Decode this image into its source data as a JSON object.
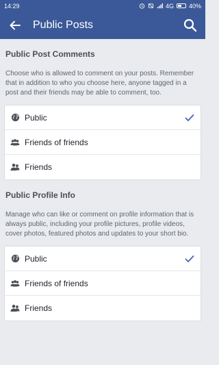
{
  "status_bar": {
    "time": "14:29",
    "network": "4G",
    "battery": "40%"
  },
  "header": {
    "title": "Public Posts"
  },
  "sections": [
    {
      "title": "Public Post Comments",
      "description": "Choose who is allowed to comment on your posts. Remember that in addition to who you choose here, anyone tagged in a post and their friends may be able to comment, too.",
      "options": [
        {
          "label": "Public",
          "icon": "globe-icon",
          "selected": true
        },
        {
          "label": "Friends of friends",
          "icon": "friends-of-friends-icon",
          "selected": false
        },
        {
          "label": "Friends",
          "icon": "friends-icon",
          "selected": false
        }
      ]
    },
    {
      "title": "Public Profile Info",
      "description": "Manage who can like or comment on profile information that is always public, including your profile pictures, profile videos, cover photos, featured photos and updates to your short bio.",
      "options": [
        {
          "label": "Public",
          "icon": "globe-icon",
          "selected": true
        },
        {
          "label": "Friends of friends",
          "icon": "friends-of-friends-icon",
          "selected": false
        },
        {
          "label": "Friends",
          "icon": "friends-icon",
          "selected": false
        }
      ]
    }
  ],
  "colors": {
    "brand": "#3b5998",
    "check": "#4267b2",
    "background": "#e9ebee"
  }
}
